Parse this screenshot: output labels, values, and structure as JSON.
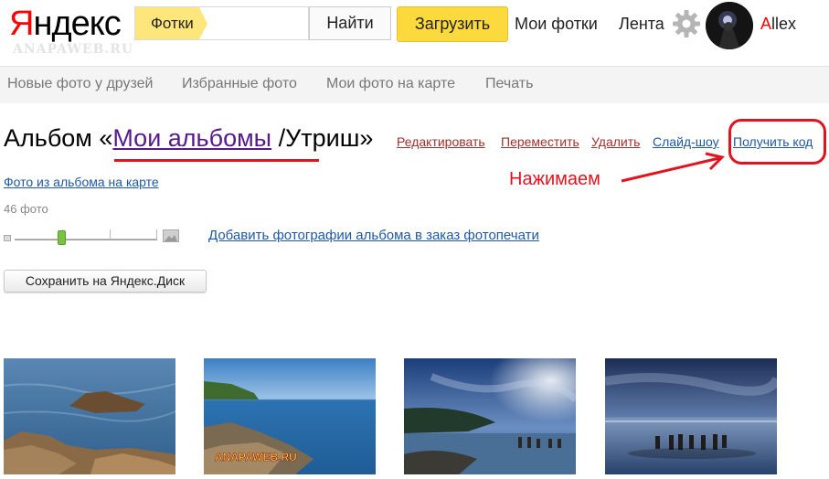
{
  "header": {
    "logo": "Яндекс",
    "watermark": "ANAPAWEB.RU",
    "search_tag": "Фотки",
    "find_label": "Найти",
    "upload_label": "Загрузить",
    "nav_my_photos": "Мои фотки",
    "nav_feed": "Лента",
    "username": "Allex"
  },
  "subnav": {
    "items": [
      "Новые фото у друзей",
      "Избранные фото",
      "Мои фото на карте",
      "Печать"
    ]
  },
  "album": {
    "prefix": "Альбом «",
    "parent_link": "Мои альбомы",
    "name": " /Утриш»",
    "actions": {
      "edit": "Редактировать",
      "move": "Переместить",
      "delete": "Удалить",
      "slideshow": "Слайд-шоу",
      "get_code": "Получить код"
    },
    "annotation": "Нажимаем",
    "map_link": "Фото из альбома на карте",
    "photo_count": "46 фото",
    "print_link": "Добавить фотографии альбома в заказ фотопечати",
    "save_disk": "Сохранить на Яндекс.Диск",
    "slider_value": 0.33
  },
  "thumbnails": [
    {
      "alt": "sea-rocks-thumbnail"
    },
    {
      "alt": "coast-rocks-thumbnail",
      "watermark": "ANAPAWEB.RU"
    },
    {
      "alt": "moon-coast-thumbnail"
    },
    {
      "alt": "night-pier-thumbnail"
    }
  ],
  "colors": {
    "accent_red": "#e0141e",
    "upload_yellow": "#fcd93d",
    "link_blue": "#1f57a5",
    "visited_purple": "#551a8b",
    "action_red": "#a0302c"
  },
  "icons": [
    "gear-icon",
    "avatar",
    "slider-small-icon",
    "slider-big-icon"
  ]
}
